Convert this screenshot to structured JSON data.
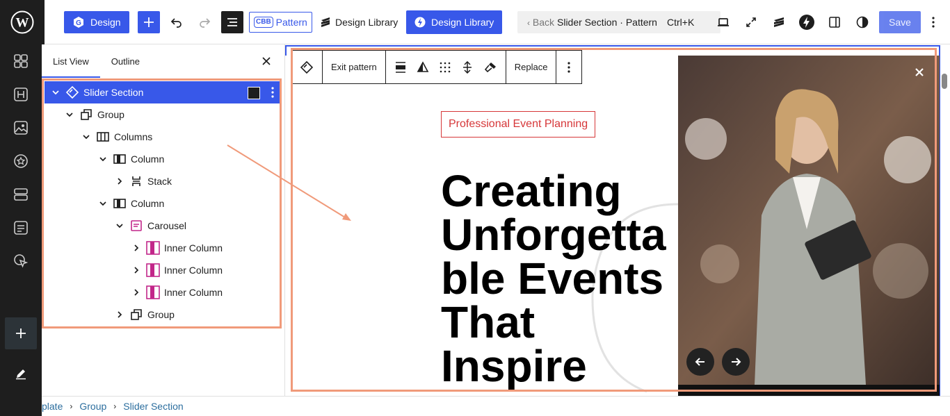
{
  "topbar": {
    "design_label": "Design",
    "pattern_label": "Pattern",
    "pattern_badge": "CBB",
    "design_library_text": "Design Library",
    "design_library_button": "Design Library",
    "command_back": "Back",
    "command_title": "Slider Section · Pattern",
    "command_shortcut": "Ctrl+K",
    "save_label": "Save"
  },
  "panel": {
    "tabs": [
      "List View",
      "Outline"
    ],
    "tree": [
      {
        "label": "Slider Section",
        "depth": 0,
        "expanded": true,
        "icon": "pattern-icon",
        "selected": true
      },
      {
        "label": "Group",
        "depth": 1,
        "expanded": true,
        "icon": "group-icon"
      },
      {
        "label": "Columns",
        "depth": 2,
        "expanded": true,
        "icon": "columns-icon"
      },
      {
        "label": "Column",
        "depth": 3,
        "expanded": true,
        "icon": "column-icon"
      },
      {
        "label": "Stack",
        "depth": 4,
        "expanded": false,
        "icon": "stack-icon"
      },
      {
        "label": "Column",
        "depth": 3,
        "expanded": true,
        "icon": "column-icon"
      },
      {
        "label": "Carousel",
        "depth": 4,
        "expanded": true,
        "icon": "carousel-icon"
      },
      {
        "label": "Inner Column",
        "depth": 5,
        "expanded": false,
        "icon": "inner-column-icon"
      },
      {
        "label": "Inner Column",
        "depth": 5,
        "expanded": false,
        "icon": "inner-column-icon"
      },
      {
        "label": "Inner Column",
        "depth": 5,
        "expanded": false,
        "icon": "inner-column-icon"
      },
      {
        "label": "Group",
        "depth": 4,
        "expanded": false,
        "icon": "group-icon"
      }
    ]
  },
  "block_toolbar": {
    "exit_pattern": "Exit pattern",
    "replace": "Replace"
  },
  "canvas": {
    "eyebrow": "Professional Event Planning",
    "title": "Creating Unforgetta ble Events That Inspire"
  },
  "breadcrumbs": [
    "plate",
    "Group",
    "Slider Section"
  ],
  "colors": {
    "accent": "#3858e9",
    "highlight": "#f09a7a",
    "eyebrow": "#d63638"
  }
}
